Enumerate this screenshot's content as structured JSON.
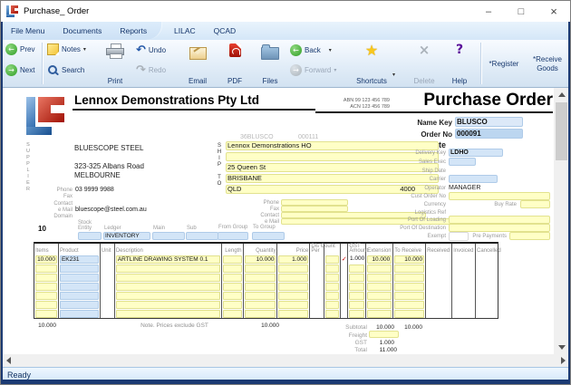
{
  "window": {
    "title": "Purchase_ Order"
  },
  "window_controls": {
    "minimize": "–",
    "maximize": "□",
    "close": "×"
  },
  "menu": {
    "items": [
      {
        "label": "File Menu"
      },
      {
        "label": "Documents"
      },
      {
        "label": "Reports"
      }
    ],
    "right_items": [
      {
        "label": "LILAC"
      },
      {
        "label": "QCAD"
      }
    ]
  },
  "toolbar": {
    "prev": "Prev",
    "next": "Next",
    "notes": "Notes",
    "search": "Search",
    "print": "Print",
    "undo": "Undo",
    "redo": "Redo",
    "email": "Email",
    "pdf": "PDF",
    "files": "Files",
    "back": "Back",
    "forward": "Forward",
    "shortcuts": "Shortcuts",
    "delete": "Delete",
    "help": "Help",
    "register": "*Register",
    "receive_goods": "*Receive Goods"
  },
  "icons": {
    "caret": "▾",
    "undo_arrow": "↶",
    "redo_arrow": "↷",
    "prev_arrow": "←",
    "next_arrow": "→",
    "back_arrow": "←",
    "forward_arrow": "→",
    "delete_x": "×",
    "help_mark": "?",
    "star": "★"
  },
  "header": {
    "company": "Lennox Demonstrations Pty Ltd",
    "abn": "ABN 99 123 456 789",
    "acn": "ACN 123 456 789",
    "doc_title": "Purchase Order"
  },
  "keys": {
    "name_key_label": "Name Key",
    "name_key": "BLUSCO",
    "order_no_label": "Order No",
    "order_no": "000091",
    "date_label": "Date"
  },
  "refs": {
    "code": "36BLUSCO",
    "number": "000111"
  },
  "supplier": {
    "vertical_label": "SUPPLIER",
    "name": "BLUESCOPE STEEL",
    "address": "323-325 Albans Road",
    "city": "MELBOURNE",
    "phone_label": "Phone",
    "phone": "03 9999 9988",
    "fax_label": "Fax",
    "contact_label": "Contact",
    "email_label": "e Mail",
    "email": "bluescope@steel.com.au",
    "domain_label": "Domain"
  },
  "shipto": {
    "vertical_label": "SHIP TO",
    "name": "Lennox Demonstrations HO",
    "street": "25 Queen St",
    "city": "BRISBANE",
    "state": "QLD",
    "postcode": "4000",
    "phone_label": "Phone",
    "fax_label": "Fax",
    "contact_label": "Contact",
    "email_label": "e Mail"
  },
  "details": {
    "delivery_key_label": "Delivery Key",
    "delivery_key": "LDHO",
    "sales_exec_label": "Sales Exec",
    "ship_date_label": "Ship Date",
    "carrier_label": "Carrier",
    "operator_label": "Operator",
    "operator": "MANAGER",
    "cust_order_no_label": "Cust Order No",
    "currency_label": "Currency",
    "buy_rate_label": "Buy Rate",
    "logistics_ref_label": "Logistics Ref",
    "port_of_loading_label": "Port Of Loading",
    "port_of_destination_label": "Port Of Destination",
    "exempt_label": "Exempt",
    "pre_payments_label": "Pre Payments"
  },
  "ledger_row": {
    "number": "10",
    "stock_entity_label": "Stock Entity",
    "ledger_label": "Ledger",
    "ledger": "INVENTORY",
    "main_label": "Main",
    "sub_label": "Sub",
    "from_group_label": "From Group",
    "to_group_label": "To Group"
  },
  "table": {
    "h": {
      "items": "Items",
      "product": "Product",
      "unit": "Unit",
      "description": "Description",
      "length": "Length",
      "quantity": "Quantity",
      "price": "Price",
      "per": "Per",
      "discount": "Dis Count",
      "gst": "GST",
      "amount": "Amount",
      "extension": "Extension",
      "to_receive": "To Receive",
      "received": "Received",
      "invoiced": "Invoiced",
      "cancelled": "Cancelled"
    },
    "row1": {
      "items": "10.000",
      "product": "EK231",
      "description": "ARTLINE DRAWING SYSTEM 0.1",
      "quantity": "10.000",
      "price": "1.000",
      "gst_check": "✓",
      "gst_amount": "1.000",
      "extension": "10.000",
      "to_receive": "10.000"
    },
    "items_total": "10.000",
    "note": "Note. Prices exclude GST",
    "quantity_total": "10.000"
  },
  "totals": {
    "subtotal_label": "Subtotal",
    "subtotal_extension": "10.000",
    "subtotal_to_receive": "10.000",
    "freight_label": "Freight",
    "gst_label": "GST",
    "gst": "1.000",
    "total_label": "Total",
    "total": "11.000"
  },
  "status": {
    "text": "Ready"
  },
  "colors": {
    "field_yellow": "#FFFFC6",
    "field_blue": "#D3E5F7",
    "navy_text": "#17386E",
    "brand_red": "#BE2B1E",
    "brand_blue": "#2563A8",
    "check_red": "#CC0000"
  }
}
